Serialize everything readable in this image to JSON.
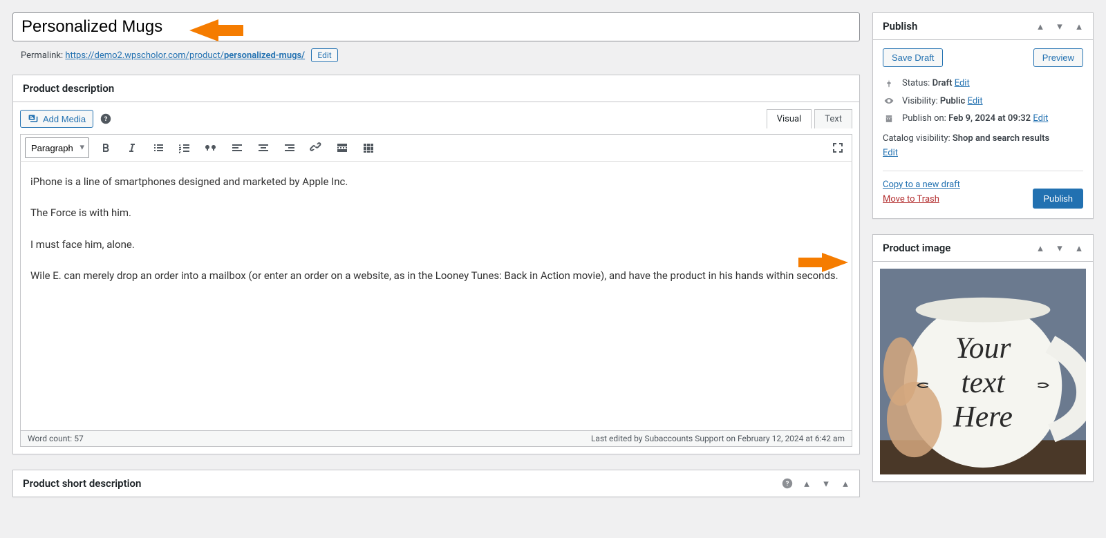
{
  "title": "Personalized Mugs",
  "permalink": {
    "label": "Permalink:",
    "base": "https://demo2.wpscholor.com/product/",
    "slug": "personalized-mugs/",
    "edit": "Edit"
  },
  "editor": {
    "heading": "Product description",
    "add_media": "Add Media",
    "tabs": {
      "visual": "Visual",
      "text": "Text"
    },
    "format_select": "Paragraph",
    "content_p1": "iPhone is a line of smartphones designed and marketed by Apple Inc.",
    "content_p2": "The Force is with him.",
    "content_p3": "I must face him, alone.",
    "content_p4": "Wile E. can merely drop an order into a mailbox (or enter an order on a website, as in the Looney Tunes: Back in Action movie), and have the product in his hands within seconds.",
    "word_count_label": "Word count:",
    "word_count_value": "57",
    "last_edited": "Last edited by Subaccounts Support on February 12, 2024 at 6:42 am"
  },
  "short_desc_heading": "Product short description",
  "publish": {
    "heading": "Publish",
    "save_draft": "Save Draft",
    "preview": "Preview",
    "status_label": "Status:",
    "status_value": "Draft",
    "visibility_label": "Visibility:",
    "visibility_value": "Public",
    "publish_on_label": "Publish on:",
    "publish_on_value": "Feb 9, 2024 at 09:32",
    "catalog_label": "Catalog visibility:",
    "catalog_value": "Shop and search results",
    "edit_link": "Edit",
    "copy_link": "Copy to a new draft",
    "trash_link": "Move to Trash",
    "publish_btn": "Publish"
  },
  "product_image": {
    "heading": "Product image",
    "line1": "Your",
    "line2": "text",
    "line3": "Here"
  }
}
